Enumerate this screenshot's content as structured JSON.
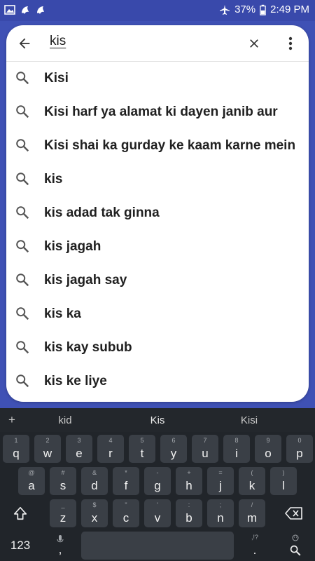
{
  "status_bar": {
    "left_icons": [
      "image-icon",
      "notification-app-icon",
      "notification-app-icon"
    ],
    "battery_percent": "37%",
    "time": "2:49 PM"
  },
  "search": {
    "query": "kis"
  },
  "suggestions": [
    "Kisi",
    "Kisi harf ya alamat ki dayen janib aur",
    "Kisi shai ka gurday ke kaam karne mein",
    "kis",
    "kis adad tak ginna",
    "kis jagah",
    "kis jagah say",
    "kis ka",
    "kis kay subub",
    "kis ke liye"
  ],
  "keyboard": {
    "plus": "+",
    "predictions": [
      "kid",
      "Kis",
      "Kisi"
    ],
    "row1": [
      {
        "hint": "1",
        "key": "q"
      },
      {
        "hint": "2",
        "key": "w"
      },
      {
        "hint": "3",
        "key": "e"
      },
      {
        "hint": "4",
        "key": "r"
      },
      {
        "hint": "5",
        "key": "t"
      },
      {
        "hint": "6",
        "key": "y"
      },
      {
        "hint": "7",
        "key": "u"
      },
      {
        "hint": "8",
        "key": "i"
      },
      {
        "hint": "9",
        "key": "o"
      },
      {
        "hint": "0",
        "key": "p"
      }
    ],
    "row2": [
      {
        "hint": "@",
        "key": "a"
      },
      {
        "hint": "#",
        "key": "s"
      },
      {
        "hint": "&",
        "key": "d"
      },
      {
        "hint": "*",
        "key": "f"
      },
      {
        "hint": "-",
        "key": "g"
      },
      {
        "hint": "+",
        "key": "h"
      },
      {
        "hint": "=",
        "key": "j"
      },
      {
        "hint": "(",
        "key": "k"
      },
      {
        "hint": ")",
        "key": "l"
      }
    ],
    "row3": [
      {
        "hint": "_",
        "key": "z"
      },
      {
        "hint": "$",
        "key": "x"
      },
      {
        "hint": "\"",
        "key": "c"
      },
      {
        "hint": "'",
        "key": "v"
      },
      {
        "hint": ":",
        "key": "b"
      },
      {
        "hint": ";",
        "key": "n"
      },
      {
        "hint": "/",
        "key": "m"
      }
    ],
    "symbols_label": "123",
    "comma_hint": ",!?",
    "period_hint": "."
  },
  "colors": {
    "status_bar": "#3949ab",
    "app_bar": "#3f51b5",
    "keyboard_bg": "#21252a",
    "key_bg": "#3a3f46"
  }
}
